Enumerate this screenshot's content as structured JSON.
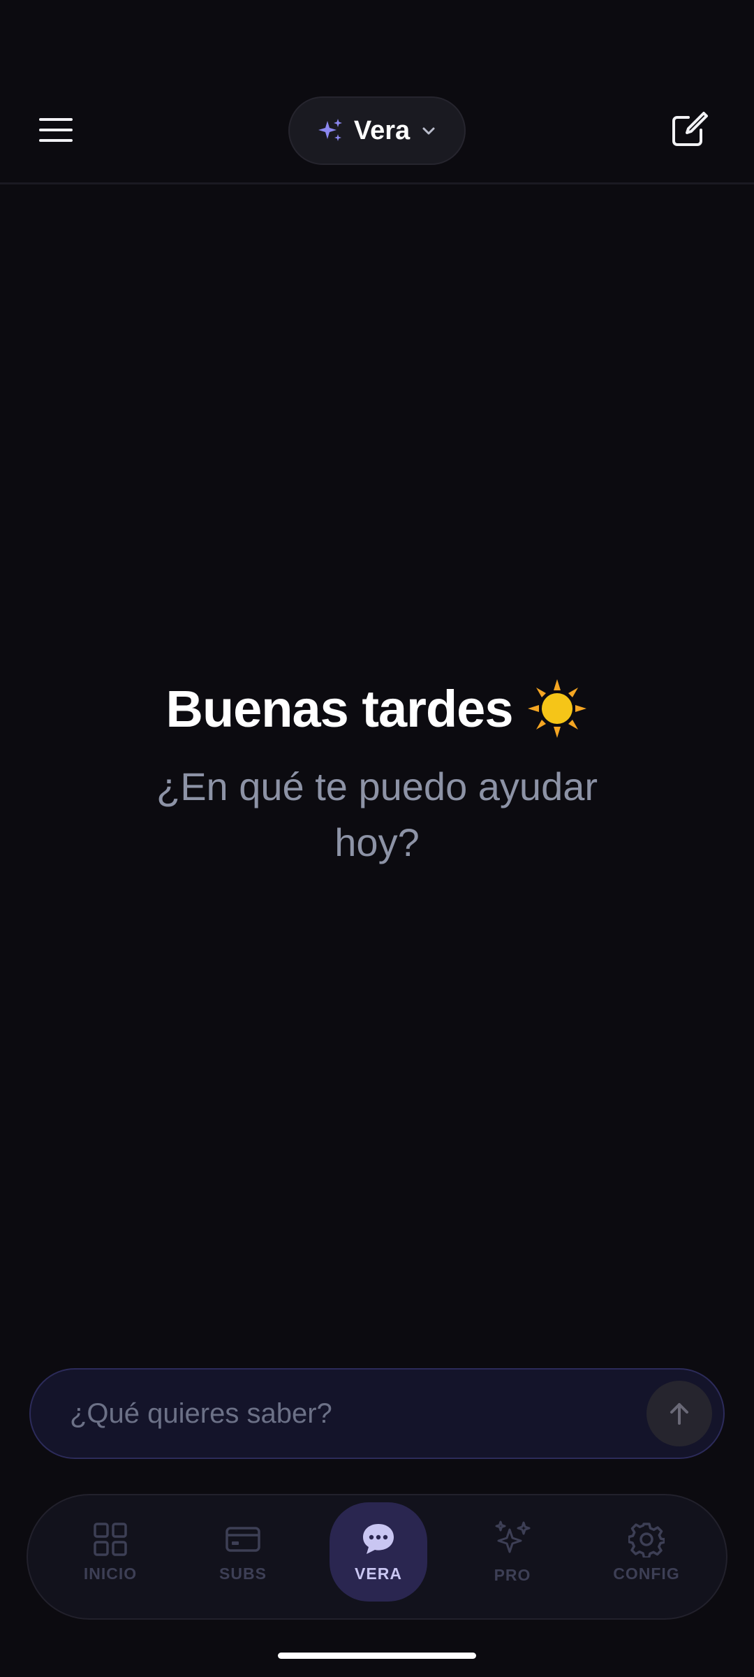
{
  "header": {
    "menu_icon": "hamburger-menu-icon",
    "model_selector": {
      "icon": "sparkles-icon",
      "label": "Vera",
      "chevron_icon": "chevron-down-icon"
    },
    "new_chat_icon": "compose-icon"
  },
  "greeting": {
    "title": "Buenas tardes",
    "emoji": "sun-icon",
    "subtitle": "¿En qué te puedo ayudar hoy?"
  },
  "composer": {
    "placeholder": "¿Qué quieres saber?",
    "value": "",
    "send_icon": "arrow-up-icon"
  },
  "nav": {
    "items": [
      {
        "label": "INICIO",
        "icon": "grid-icon",
        "active": false
      },
      {
        "label": "SUBS",
        "icon": "card-icon",
        "active": false
      },
      {
        "label": "VERA",
        "icon": "chat-bubble-icon",
        "active": true
      },
      {
        "label": "PRO",
        "icon": "sparkles-icon",
        "active": false
      },
      {
        "label": "CONFIG",
        "icon": "gear-icon",
        "active": false
      }
    ]
  },
  "colors": {
    "background": "#0c0b10",
    "accent": "#8b87f0",
    "active_nav_bg": "#2a2650",
    "muted_text": "#8d93a6",
    "sun": "#f5c518"
  }
}
